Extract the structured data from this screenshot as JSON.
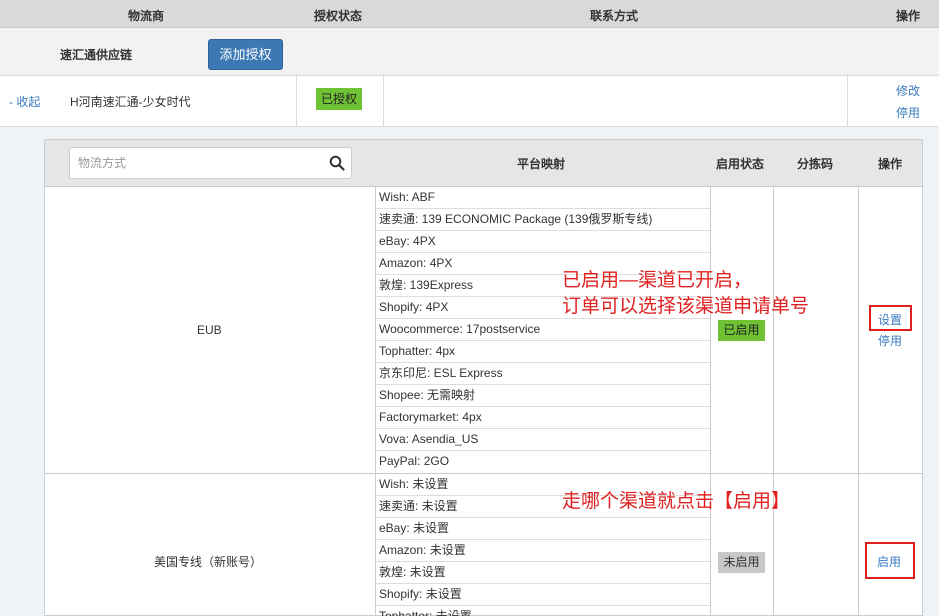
{
  "header": {
    "col_carrier": "物流商",
    "col_auth_status": "授权状态",
    "col_contact": "联系方式",
    "col_action": "操作"
  },
  "supplier": {
    "name": "速汇通供应链",
    "add_auth_label": "添加授权"
  },
  "account": {
    "collapse_label": "- 收起",
    "name": "H河南速汇通-少女时代",
    "auth_status": "已授权",
    "edit_label": "修改",
    "disable_label": "停用"
  },
  "channel_table": {
    "search_placeholder": "物流方式",
    "col_platform_mapping": "平台映射",
    "col_enable_status": "启用状态",
    "col_sort_code": "分拣码",
    "col_action": "操作"
  },
  "channels": [
    {
      "name": "EUB",
      "mappings": [
        "Wish:  ABF",
        "速卖通:  139 ECONOMIC Package (139俄罗斯专线)",
        "eBay:  4PX",
        "Amazon:  4PX",
        "敦煌:  139Express",
        "Shopify:  4PX",
        "Woocommerce:  17postservice",
        "Tophatter:  4px",
        "京东印尼:  ESL Express",
        "Shopee:  无需映射",
        "Factorymarket:  4px",
        "Vova:  Asendia_US",
        "PayPal:  2GO"
      ],
      "status": "已启用",
      "actions": [
        "设置",
        "停用"
      ]
    },
    {
      "name": "美国专线（新账号）",
      "mappings": [
        "Wish:  未设置",
        "速卖通:  未设置",
        "eBay:  未设置",
        "Amazon:  未设置",
        "敦煌:  未设置",
        "Shopify:  未设置",
        "Tophatter:  未设置"
      ],
      "status": "未启用",
      "actions": [
        "启用"
      ]
    }
  ],
  "annotations": {
    "note1_line1": "已启用—渠道已开启，",
    "note1_line2": "订单可以选择该渠道申请单号",
    "note2": "走哪个渠道就点击【启用】"
  },
  "colors": {
    "header_bg": "#d9d9d9",
    "button_blue": "#3c78b4",
    "status_green": "#6ec234",
    "status_gray": "#c8c8c8",
    "link_blue": "#3a7bbf",
    "annotation_red": "#e02020"
  }
}
